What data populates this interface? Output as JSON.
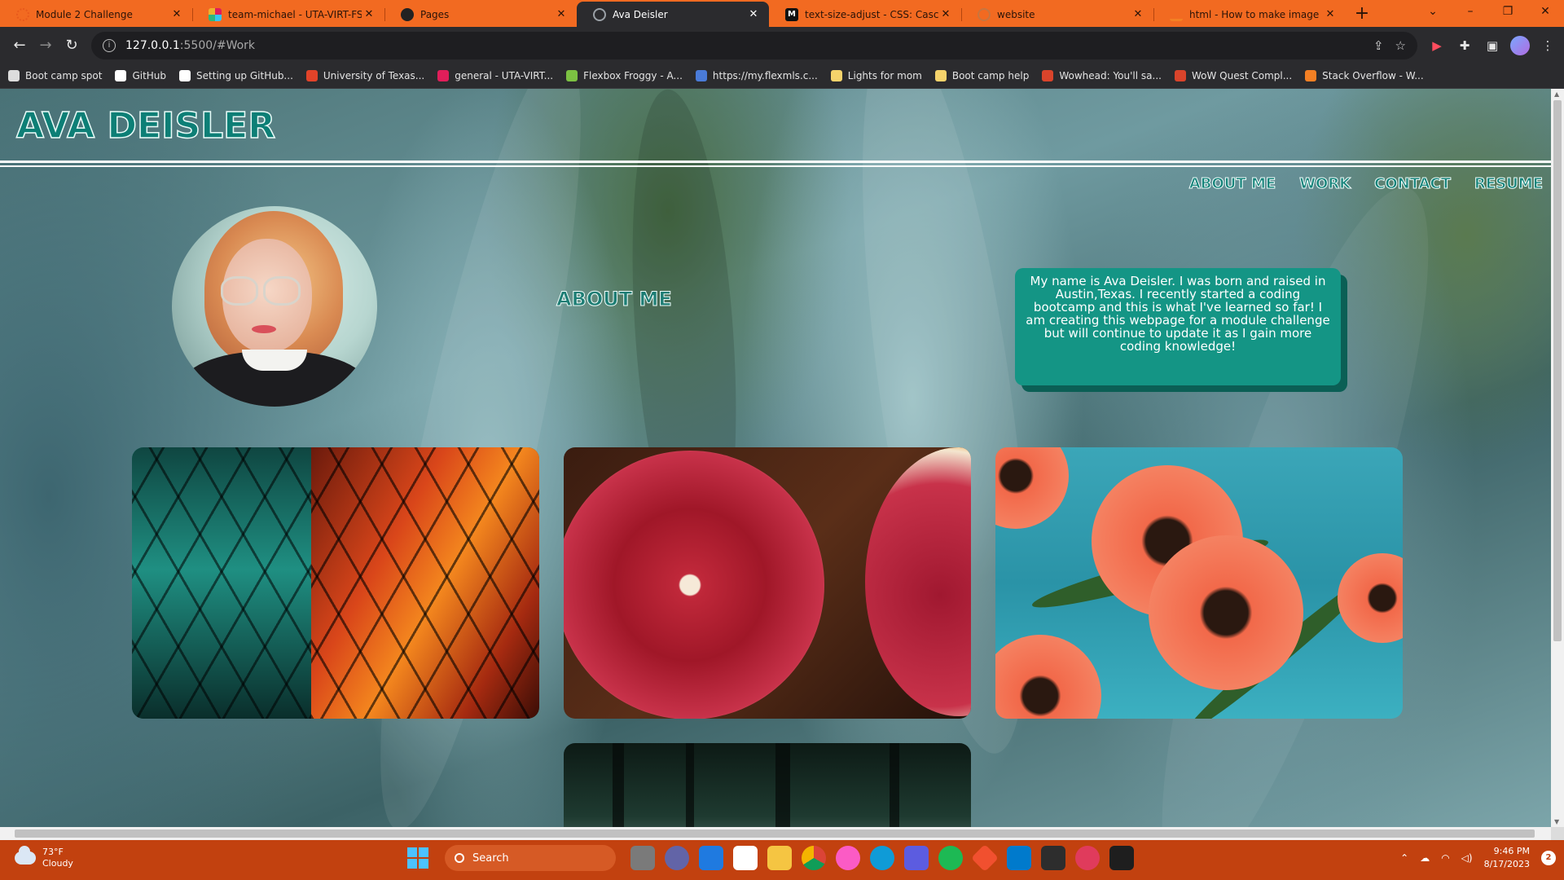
{
  "browser": {
    "tabs": [
      {
        "label": "Module 2 Challenge",
        "favicon_color": "#e85a1c",
        "active": false
      },
      {
        "label": "team-michael - UTA-VIRT-FSF-P",
        "favicon_color": "#e01e5a",
        "active": false
      },
      {
        "label": "Pages",
        "favicon_color": "#222222",
        "active": false
      },
      {
        "label": "Ava Deisler",
        "favicon_color": "#9aa0a6",
        "active": true
      },
      {
        "label": "text-size-adjust - CSS: Cascading",
        "favicon_color": "#111111",
        "favicon_text": "M",
        "active": false
      },
      {
        "label": "website",
        "favicon_color": "#c9753e",
        "active": false
      },
      {
        "label": "html - How to make image into",
        "favicon_color": "#f48024",
        "active": false
      }
    ],
    "new_tab": "+",
    "window_controls": {
      "dropdown": "⌄",
      "minimize": "–",
      "restore": "❐",
      "close": "✕"
    },
    "url_host": "127.0.0.1",
    "url_path": ":5500/#Work",
    "bookmarks": [
      {
        "label": "Boot camp spot",
        "color": "#dddddd"
      },
      {
        "label": "GitHub",
        "color": "#ffffff"
      },
      {
        "label": "Setting up GitHub...",
        "color": "#ffffff"
      },
      {
        "label": "University of Texas...",
        "color": "#e24329"
      },
      {
        "label": "general - UTA-VIRT...",
        "color": "#e01e5a"
      },
      {
        "label": "Flexbox Froggy - A...",
        "color": "#7cc142"
      },
      {
        "label": "https://my.flexmls.c...",
        "color": "#4a7bd8"
      },
      {
        "label": "Lights for mom",
        "color": "#f5d36b"
      },
      {
        "label": "Boot camp help",
        "color": "#f5d36b"
      },
      {
        "label": "Wowhead: You'll sa...",
        "color": "#d9442b"
      },
      {
        "label": "WoW Quest Compl...",
        "color": "#d9442b"
      },
      {
        "label": "Stack Overflow - W...",
        "color": "#f48024"
      }
    ]
  },
  "site": {
    "title": "AVA DEISLER",
    "nav": [
      "ABOUT ME",
      "WORK",
      "CONTACT",
      "RESUME"
    ],
    "about_heading": "ABOUT ME",
    "about_text": "My name is Ava Deisler. I was born and raised in Austin,Texas. I recently started a coding bootcamp and this is what I've learned so far! I am creating this webpage for a module challenge but will continue to update it as I gain more coding knowledge!",
    "accent_color": "#149585"
  },
  "taskbar": {
    "weather_temp": "73°F",
    "weather_desc": "Cloudy",
    "search_placeholder": "Search",
    "time": "9:46 PM",
    "date": "8/17/2023",
    "notifications": "2",
    "apps": [
      "task-view",
      "teams",
      "mail",
      "store",
      "file-explorer",
      "chrome",
      "itunes",
      "edge",
      "power-automate",
      "spotify",
      "git",
      "vscode",
      "terminal-tool",
      "recorder",
      "terminal"
    ]
  }
}
